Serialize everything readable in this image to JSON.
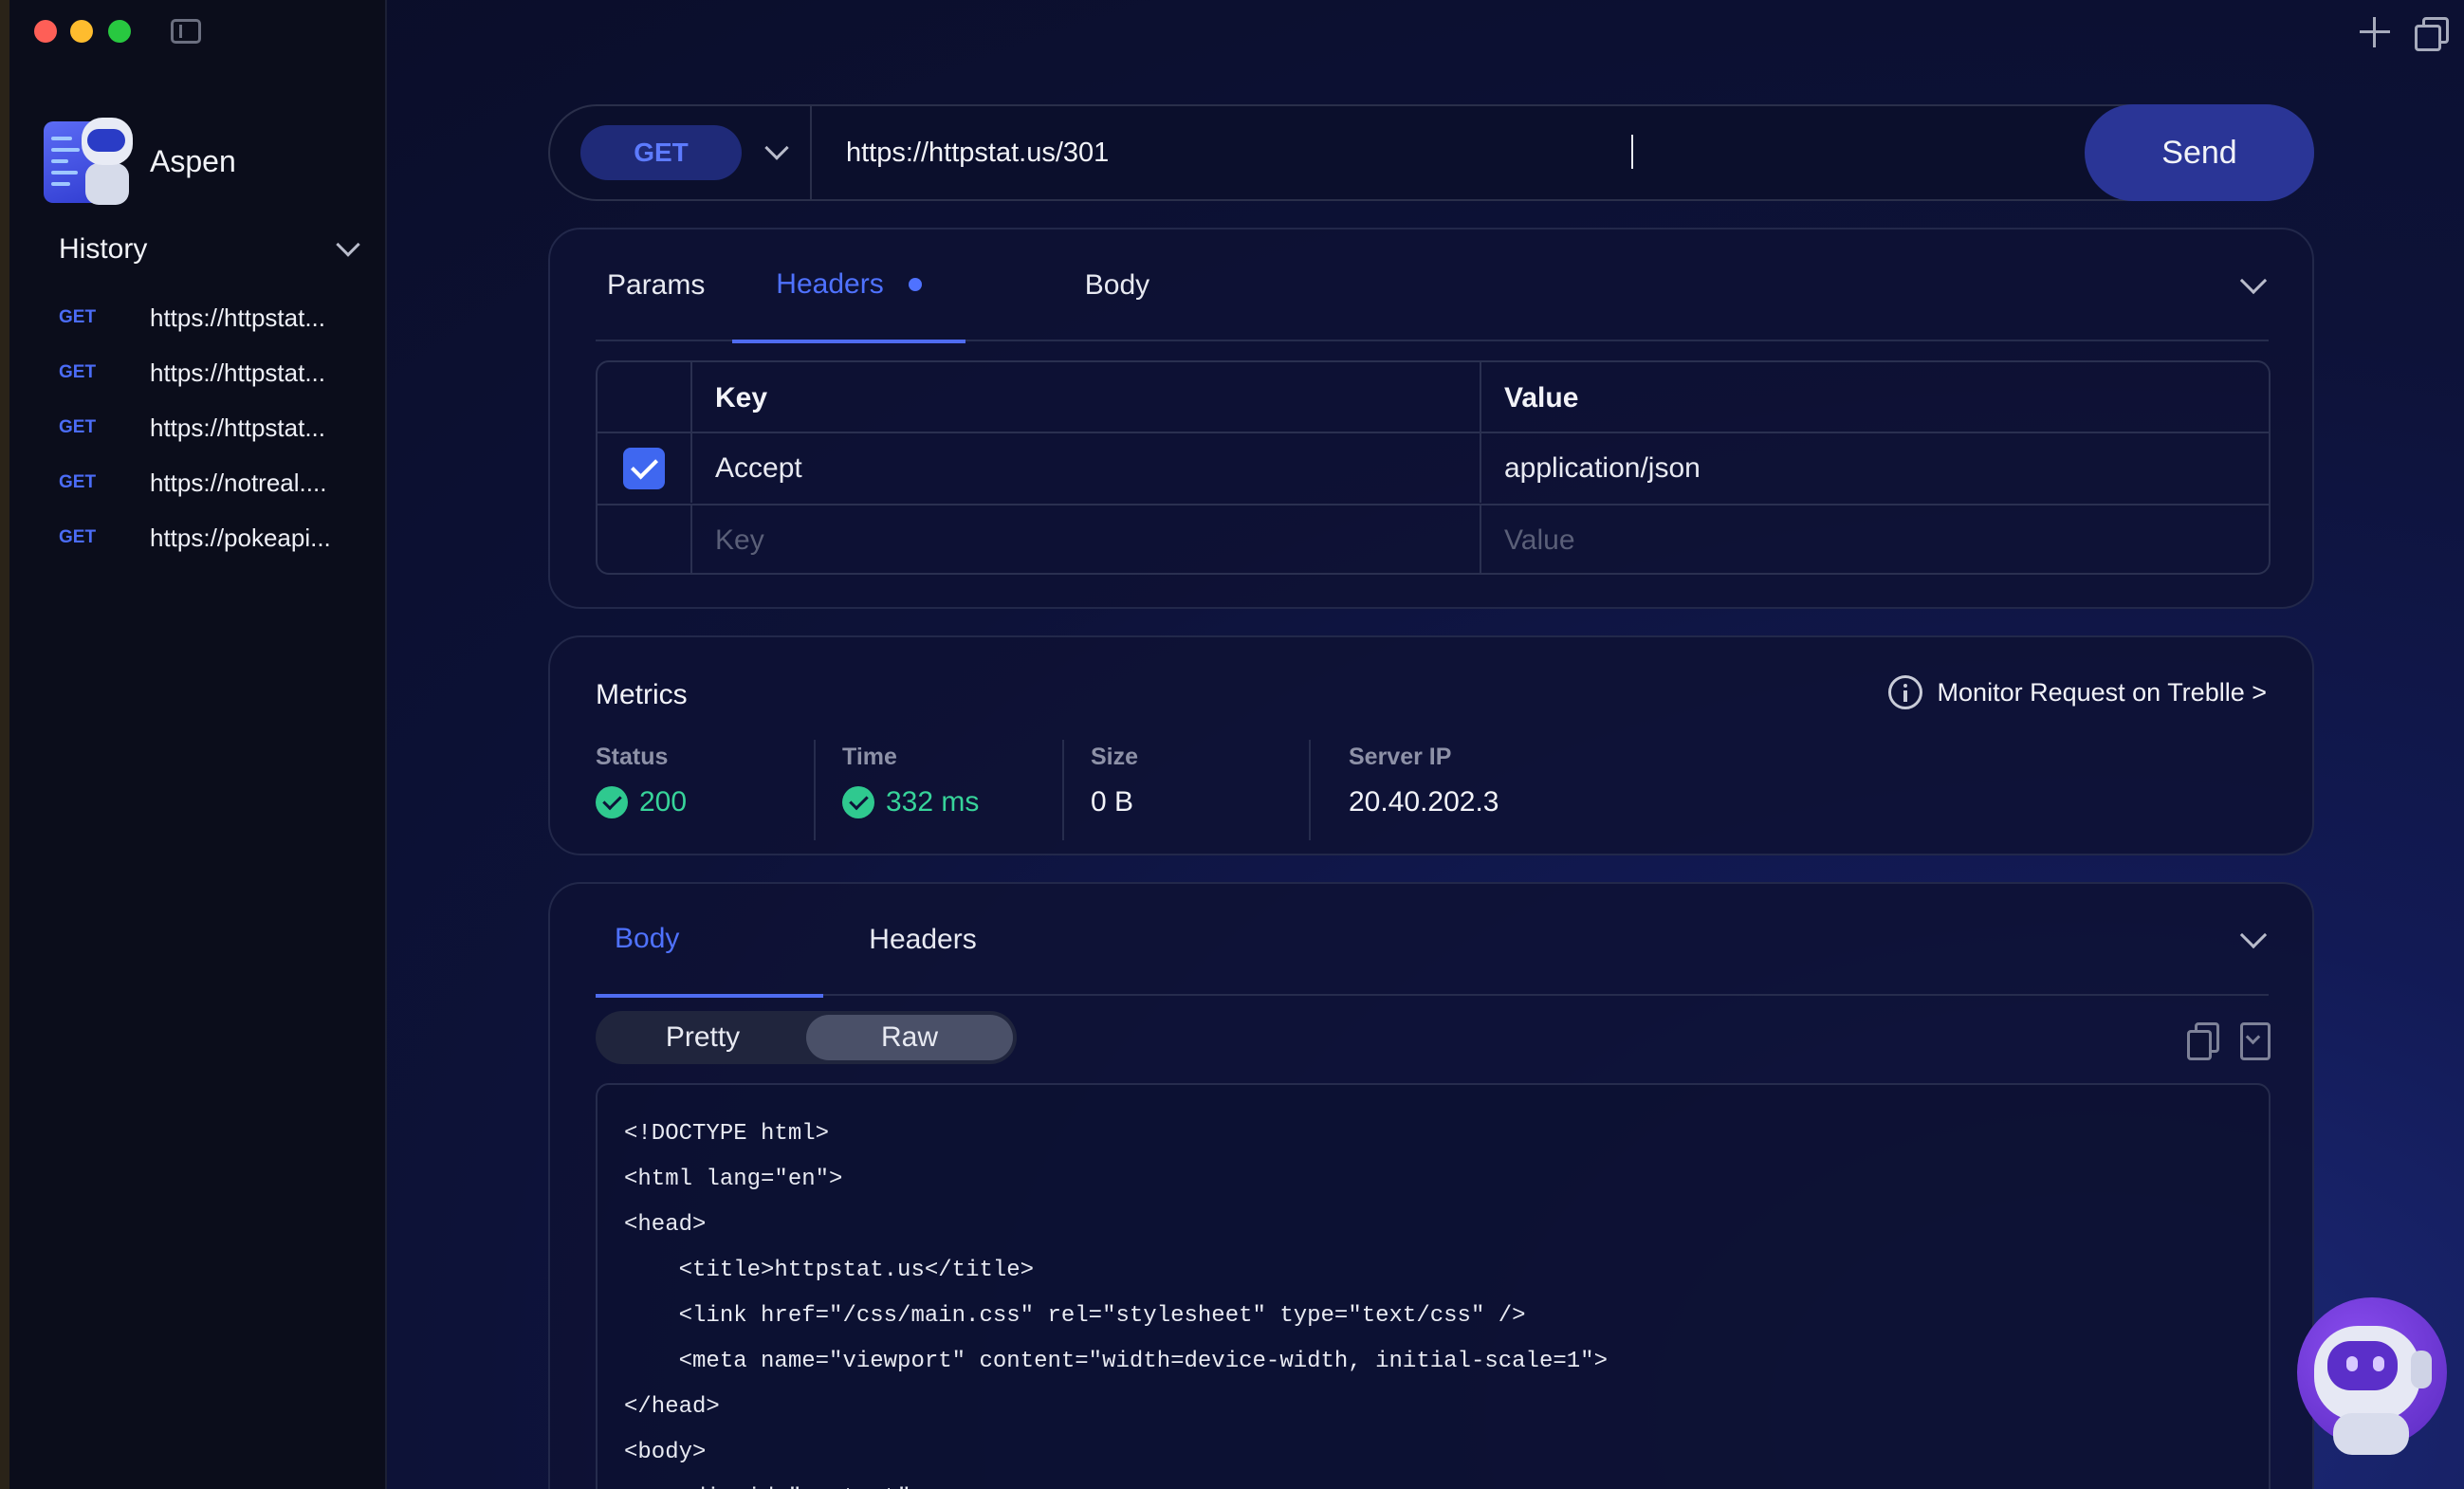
{
  "app": {
    "name": "Aspen"
  },
  "history": {
    "title": "History",
    "items": [
      {
        "method": "GET",
        "url": "https://httpstat..."
      },
      {
        "method": "GET",
        "url": "https://httpstat..."
      },
      {
        "method": "GET",
        "url": "https://httpstat..."
      },
      {
        "method": "GET",
        "url": "https://notreal...."
      },
      {
        "method": "GET",
        "url": "https://pokeapi..."
      }
    ]
  },
  "request": {
    "method": "GET",
    "url": "https://httpstat.us/301",
    "send_label": "Send",
    "tabs": [
      {
        "label": "Params",
        "active": false
      },
      {
        "label": "Headers",
        "active": true,
        "has_indicator": true
      },
      {
        "label": "Body",
        "active": false
      }
    ],
    "headers_table": {
      "columns": [
        "Key",
        "Value"
      ],
      "rows": [
        {
          "enabled": true,
          "key": "Accept",
          "value": "application/json"
        }
      ],
      "key_placeholder": "Key",
      "value_placeholder": "Value"
    }
  },
  "metrics": {
    "title": "Metrics",
    "monitor_link": "Monitor Request on Treblle >",
    "items": [
      {
        "label": "Status",
        "value": "200",
        "ok": true
      },
      {
        "label": "Time",
        "value": "332 ms",
        "ok": true
      },
      {
        "label": "Size",
        "value": "0 B",
        "ok": false
      },
      {
        "label": "Server IP",
        "value": "20.40.202.3",
        "ok": false
      }
    ]
  },
  "response": {
    "tabs": [
      {
        "label": "Body",
        "active": true
      },
      {
        "label": "Headers",
        "active": false
      }
    ],
    "view_modes": [
      {
        "label": "Pretty",
        "active": false
      },
      {
        "label": "Raw",
        "active": true
      }
    ],
    "code_lines": [
      "<!DOCTYPE html>",
      "<html lang=\"en\">",
      "<head>",
      "    <title>httpstat.us</title>",
      "    <link href=\"/css/main.css\" rel=\"stylesheet\" type=\"text/css\" />",
      "    <meta name=\"viewport\" content=\"width=device-width, initial-scale=1\">",
      "</head>",
      "<body>",
      "    <div id=\"content\">"
    ]
  },
  "colors": {
    "accent": "#4f72ff",
    "send_button": "#2a3596",
    "success": "#37d49a",
    "sidebar_bg": "#0b0d1b"
  }
}
